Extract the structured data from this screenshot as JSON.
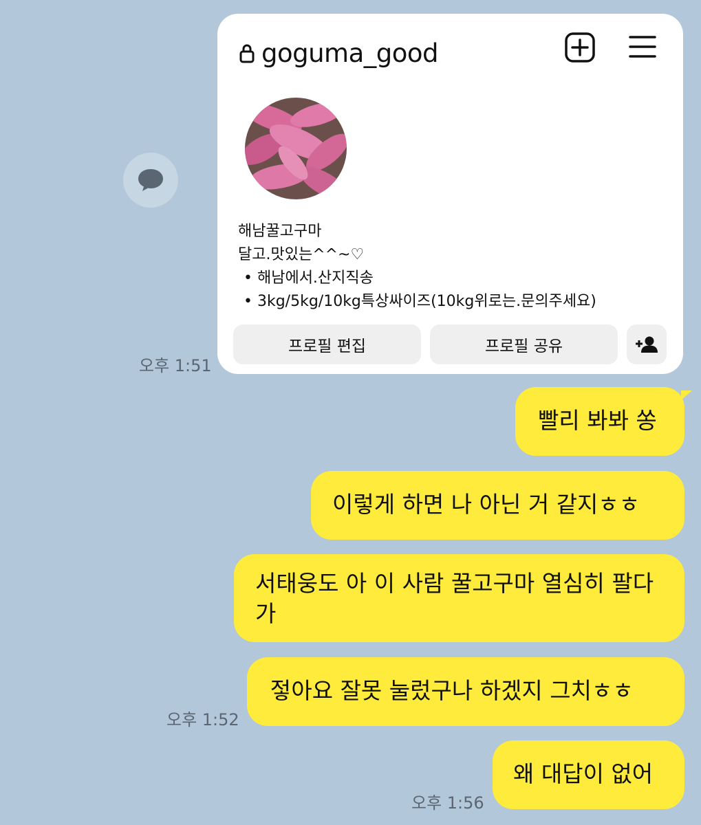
{
  "profile_card": {
    "username": "goguma_good",
    "bio": [
      "해남꿀고구마",
      "달고.맛있는^^~♡",
      "• 해남에서.산지직송",
      "• 3kg/5kg/10kg특상싸이즈(10kg위로는.문의주세요)"
    ],
    "edit_profile_label": "프로필 편집",
    "share_profile_label": "프로필 공유"
  },
  "timestamps": {
    "card_time": "오후 1:51",
    "group_time": "오후 1:52",
    "last_time": "오후 1:56"
  },
  "messages": [
    {
      "text": "빨리 봐봐 쏭"
    },
    {
      "text": "이렇게 하면 나 아닌 거 같지ㅎㅎ"
    },
    {
      "text": "서태웅도 아 이 사람 꿀고구마 열심히 팔다가"
    },
    {
      "text": "젛아요 잘못 눌렀구나 하겠지 그치ㅎㅎ"
    },
    {
      "text": "왜 대답이 없어"
    }
  ],
  "colors": {
    "chat_background": "#b2c7da",
    "my_bubble": "#feeb3b",
    "card_background": "#ffffff",
    "button_background": "#efefef"
  },
  "icons": [
    "share-icon",
    "lock-icon",
    "new-post-icon",
    "menu-icon",
    "add-person-icon"
  ]
}
